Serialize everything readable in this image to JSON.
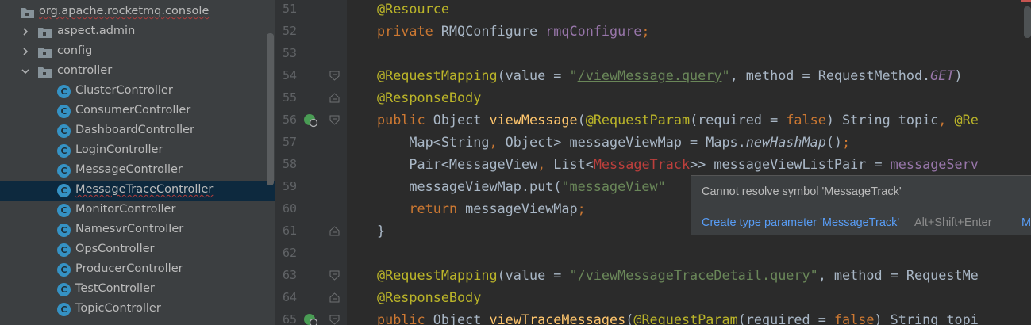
{
  "project_tree": {
    "items": [
      {
        "label": "org.apache.rocketmq.console",
        "kind": "package",
        "expanded": true,
        "depth": 0
      },
      {
        "label": "aspect.admin",
        "kind": "package",
        "expanded": false,
        "depth": 1
      },
      {
        "label": "config",
        "kind": "package",
        "expanded": false,
        "depth": 1
      },
      {
        "label": "controller",
        "kind": "package",
        "expanded": true,
        "depth": 1
      },
      {
        "label": "ClusterController",
        "kind": "class",
        "depth": 2
      },
      {
        "label": "ConsumerController",
        "kind": "class",
        "depth": 2
      },
      {
        "label": "DashboardController",
        "kind": "class",
        "depth": 2
      },
      {
        "label": "LoginController",
        "kind": "class",
        "depth": 2
      },
      {
        "label": "MessageController",
        "kind": "class",
        "depth": 2
      },
      {
        "label": "MessageTraceController",
        "kind": "class",
        "depth": 2,
        "selected": true
      },
      {
        "label": "MonitorController",
        "kind": "class",
        "depth": 2
      },
      {
        "label": "NamesvrController",
        "kind": "class",
        "depth": 2
      },
      {
        "label": "OpsController",
        "kind": "class",
        "depth": 2
      },
      {
        "label": "ProducerController",
        "kind": "class",
        "depth": 2
      },
      {
        "label": "TestController",
        "kind": "class",
        "depth": 2
      },
      {
        "label": "TopicController",
        "kind": "class",
        "depth": 2
      }
    ],
    "class_icon_letter": "C"
  },
  "editor": {
    "lines": [
      {
        "num": "51",
        "tokens": [
          {
            "t": "@Resource",
            "c": "ann"
          }
        ]
      },
      {
        "num": "52",
        "tokens": [
          {
            "t": "private ",
            "c": "kw"
          },
          {
            "t": "RMQConfigure ",
            "c": ""
          },
          {
            "t": "rmqConfigure",
            "c": "field"
          },
          {
            "t": ";",
            "c": "kw"
          }
        ]
      },
      {
        "num": "53",
        "tokens": []
      },
      {
        "num": "54",
        "tokens": [
          {
            "t": "@RequestMapping",
            "c": "ann"
          },
          {
            "t": "(value = ",
            "c": ""
          },
          {
            "t": "\"",
            "c": "str"
          },
          {
            "t": "/viewMessage.query",
            "c": "url"
          },
          {
            "t": "\"",
            "c": "str"
          },
          {
            "t": ", method = RequestMethod.",
            "c": ""
          },
          {
            "t": "GET",
            "c": "static"
          },
          {
            "t": ")",
            "c": ""
          }
        ]
      },
      {
        "num": "55",
        "tokens": [
          {
            "t": "@ResponseBody",
            "c": "ann"
          }
        ]
      },
      {
        "num": "56",
        "tokens": [
          {
            "t": "public ",
            "c": "kw"
          },
          {
            "t": "Object ",
            "c": ""
          },
          {
            "t": "viewMessage",
            "c": "method"
          },
          {
            "t": "(",
            "c": ""
          },
          {
            "t": "@RequestParam",
            "c": "ann"
          },
          {
            "t": "(required = ",
            "c": ""
          },
          {
            "t": "false",
            "c": "kw"
          },
          {
            "t": ") String topic",
            "c": ""
          },
          {
            "t": ", ",
            "c": "kw"
          },
          {
            "t": "@Re",
            "c": "ann"
          }
        ]
      },
      {
        "num": "57",
        "tokens": [
          {
            "t": "    Map<String",
            "c": ""
          },
          {
            "t": ", ",
            "c": "kw"
          },
          {
            "t": "Object> messageViewMap = Maps.",
            "c": ""
          },
          {
            "t": "newHashMap",
            "c": "italic"
          },
          {
            "t": "()",
            "c": ""
          },
          {
            "t": ";",
            "c": "kw"
          }
        ]
      },
      {
        "num": "58",
        "tokens": [
          {
            "t": "    Pair<MessageView",
            "c": ""
          },
          {
            "t": ", ",
            "c": "kw"
          },
          {
            "t": "List<",
            "c": ""
          },
          {
            "t": "MessageTrack",
            "c": "err"
          },
          {
            "t": ">> messageViewListPair = ",
            "c": ""
          },
          {
            "t": "messageServ",
            "c": "field"
          }
        ]
      },
      {
        "num": "59",
        "tokens": [
          {
            "t": "    messageViewMap.put(",
            "c": ""
          },
          {
            "t": "\"messageView\"",
            "c": "str"
          }
        ]
      },
      {
        "num": "60",
        "tokens": [
          {
            "t": "    ",
            "c": ""
          },
          {
            "t": "return ",
            "c": "kw"
          },
          {
            "t": "messageViewMap",
            "c": ""
          },
          {
            "t": ";",
            "c": "kw"
          }
        ]
      },
      {
        "num": "61",
        "tokens": [
          {
            "t": "}",
            "c": ""
          }
        ]
      },
      {
        "num": "62",
        "tokens": []
      },
      {
        "num": "63",
        "tokens": [
          {
            "t": "@RequestMapping",
            "c": "ann"
          },
          {
            "t": "(value = ",
            "c": ""
          },
          {
            "t": "\"",
            "c": "str"
          },
          {
            "t": "/viewMessageTraceDetail.query",
            "c": "url"
          },
          {
            "t": "\"",
            "c": "str"
          },
          {
            "t": ", method = RequestMe",
            "c": ""
          }
        ]
      },
      {
        "num": "64",
        "tokens": [
          {
            "t": "@ResponseBody",
            "c": "ann"
          }
        ]
      },
      {
        "num": "65",
        "tokens": [
          {
            "t": "public ",
            "c": "kw"
          },
          {
            "t": "Object ",
            "c": ""
          },
          {
            "t": "viewTraceMessages",
            "c": "method"
          },
          {
            "t": "(",
            "c": ""
          },
          {
            "t": "@RequestParam",
            "c": "ann"
          },
          {
            "t": "(required = ",
            "c": ""
          },
          {
            "t": "false",
            "c": "kw"
          },
          {
            "t": ") String topi",
            "c": ""
          }
        ]
      }
    ]
  },
  "popup": {
    "message": "Cannot resolve symbol 'MessageTrack'",
    "action": "Create type parameter 'MessageTrack'",
    "shortcut": "Alt+Shift+Enter",
    "more": "M"
  },
  "colors": {
    "editor_bg": "#2b2b2b",
    "tree_bg": "#3c3f41",
    "selection": "#0d293e",
    "annotation": "#bbb529",
    "keyword": "#cc7832",
    "string": "#6a8759",
    "field": "#9876aa",
    "method": "#ffc66d",
    "error": "#bc3f3c",
    "link": "#589df6"
  }
}
